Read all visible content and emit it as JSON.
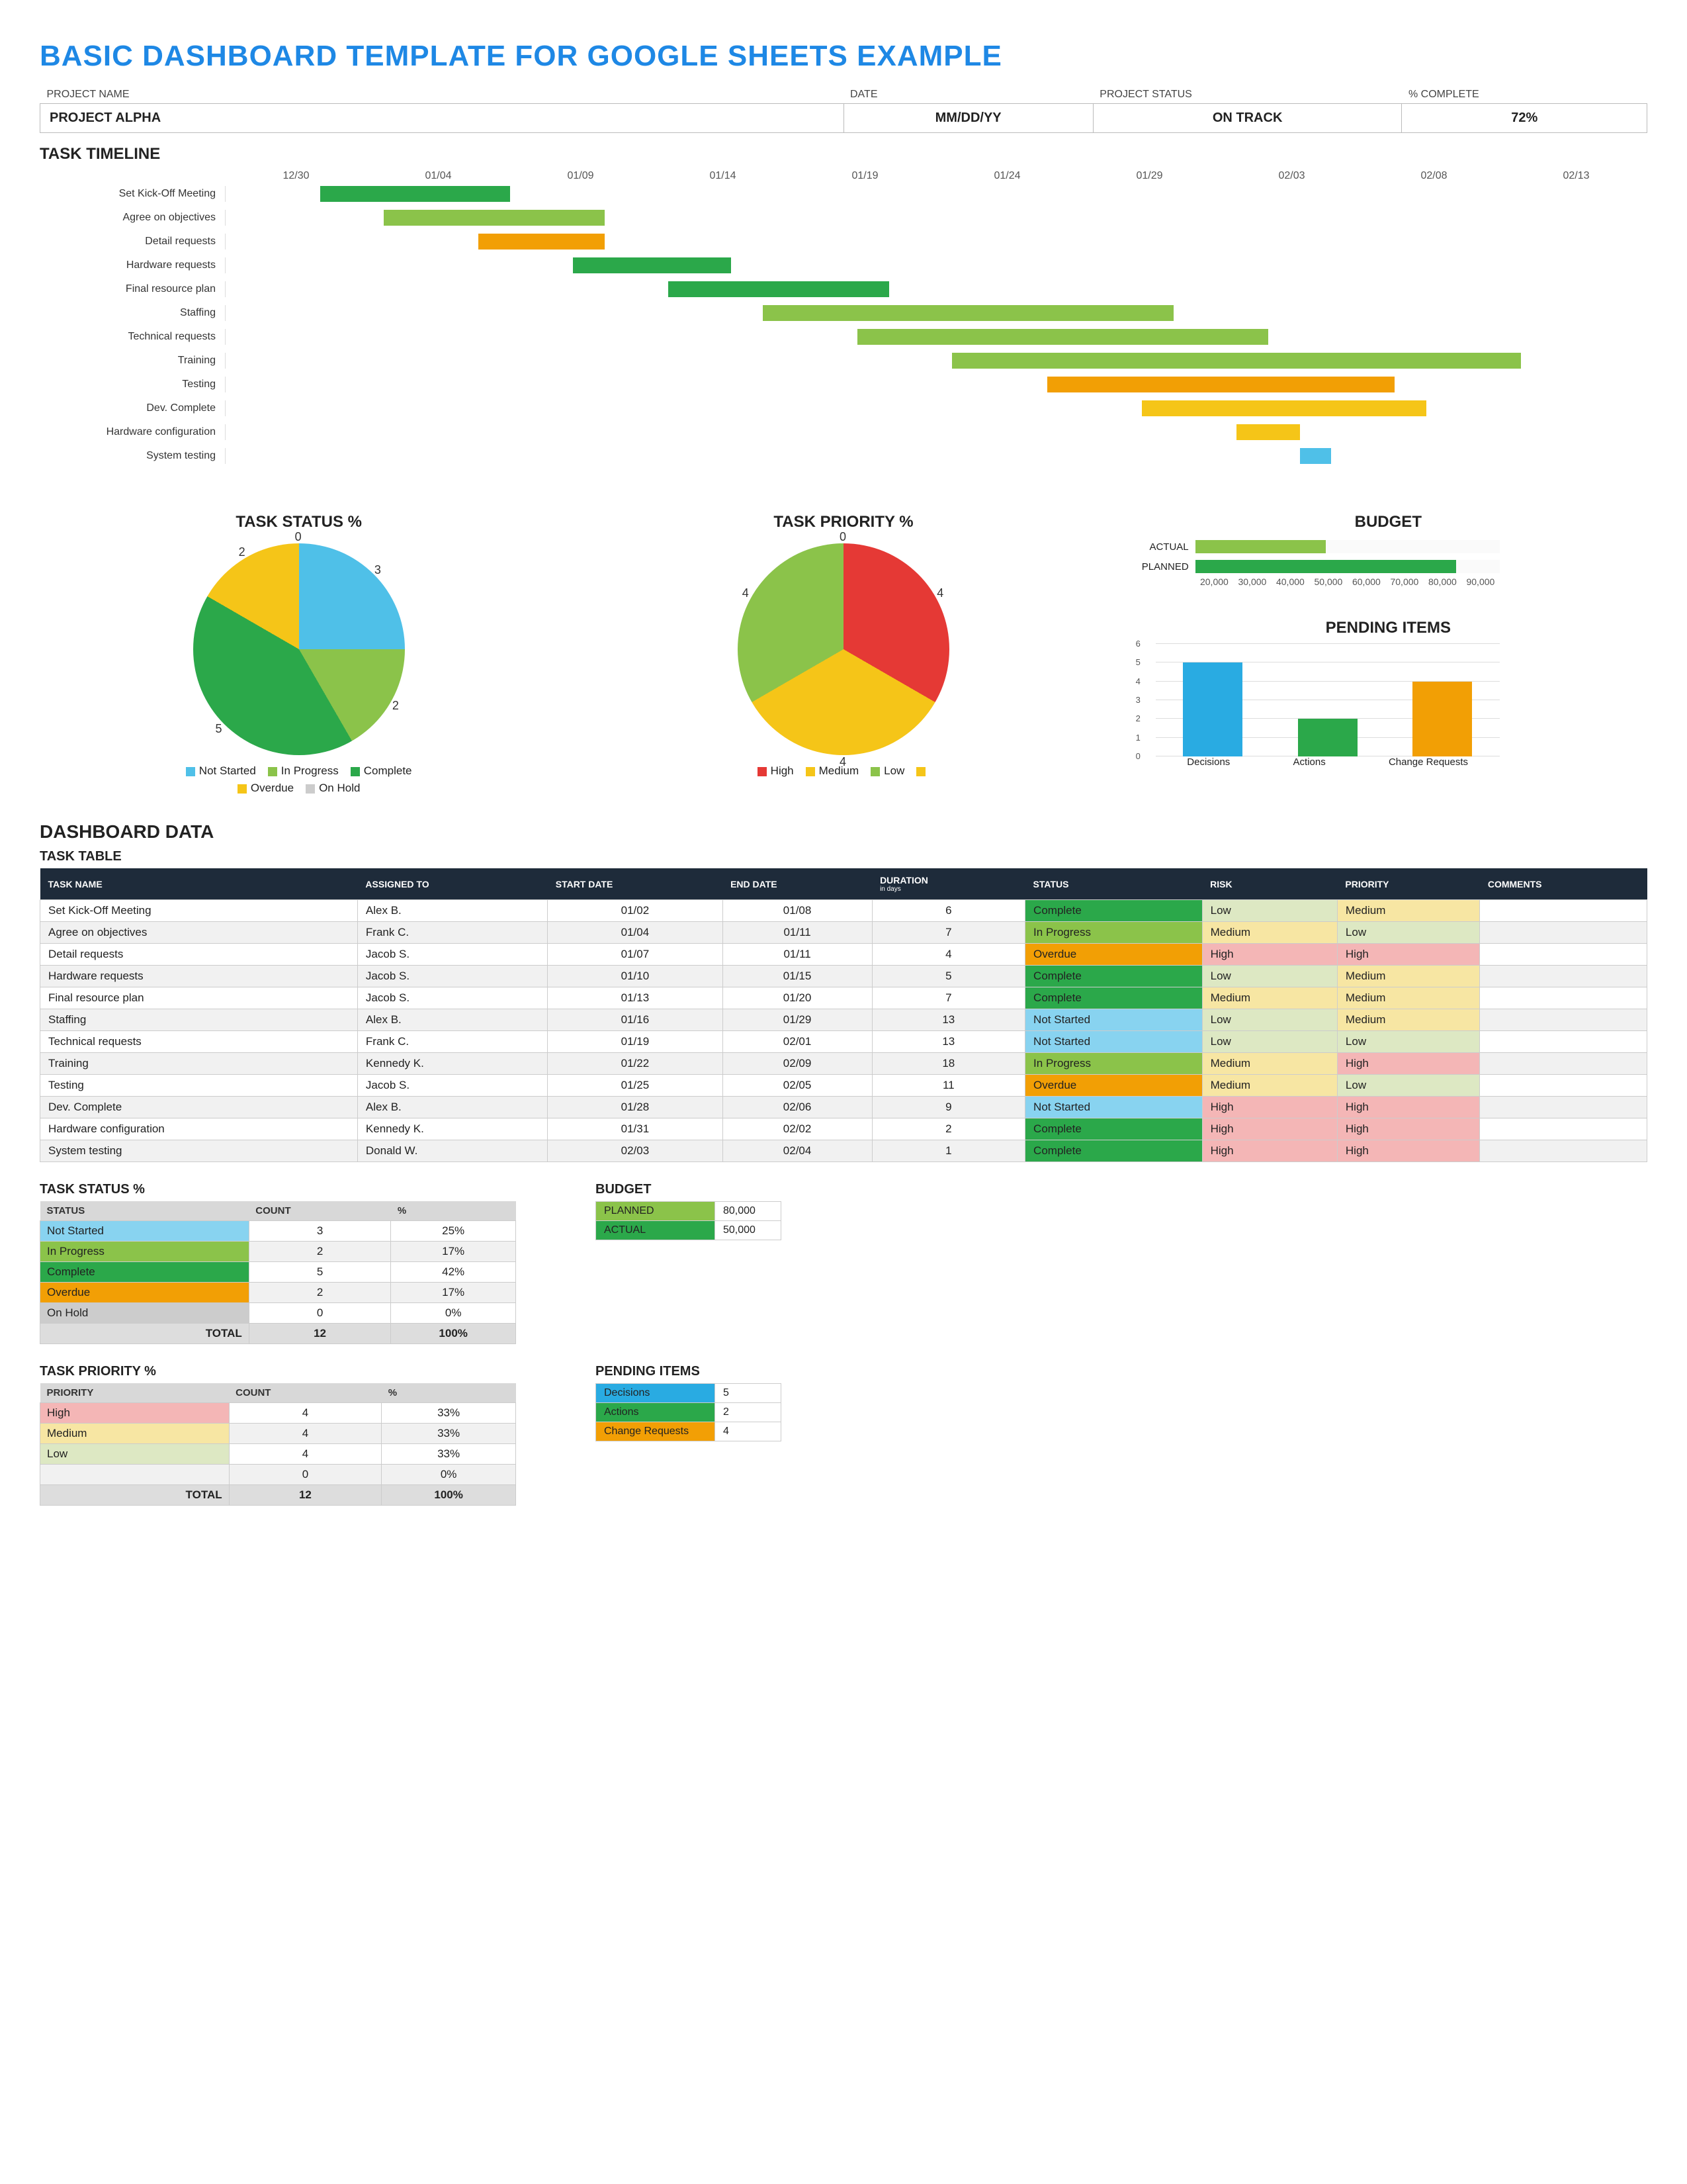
{
  "title": "BASIC DASHBOARD TEMPLATE FOR GOOGLE SHEETS EXAMPLE",
  "meta": {
    "headers": {
      "project_name": "PROJECT NAME",
      "date": "DATE",
      "status": "PROJECT STATUS",
      "complete": "% COMPLETE"
    },
    "values": {
      "project_name": "PROJECT ALPHA",
      "date": "MM/DD/YY",
      "status": "ON TRACK",
      "complete": "72%"
    }
  },
  "sections": {
    "timeline": "TASK TIMELINE",
    "status_pct": "TASK STATUS %",
    "priority_pct": "TASK PRIORITY %",
    "budget": "BUDGET",
    "pending": "PENDING ITEMS",
    "dashboard_data": "DASHBOARD DATA",
    "task_table": "TASK TABLE"
  },
  "colors": {
    "green_dark": "#2BA84A",
    "green_light": "#8BC34A",
    "yellow": "#F5C518",
    "orange": "#F29F05",
    "orange2": "#F29F05",
    "blue": "#4FC0E8",
    "blue2": "#29ABE2",
    "red": "#E53935",
    "grey": "#CCCCCC",
    "hi_bg": "#F4B6B6",
    "med_bg": "#F7E6A3",
    "low_bg": "#DDE8C3",
    "status_complete": "#2BA84A",
    "status_inprogress": "#8BC34A",
    "status_overdue": "#F29F05",
    "status_notstarted": "#88D3F0",
    "status_hold": "#CCCCCC"
  },
  "chart_data": [
    {
      "type": "bar",
      "name": "gantt",
      "categories": [
        "12/30",
        "01/04",
        "01/09",
        "01/14",
        "01/19",
        "01/24",
        "01/29",
        "02/03",
        "02/08",
        "02/13"
      ],
      "x_start": 0,
      "x_end": 45,
      "series": [
        {
          "name": "Set Kick-Off Meeting",
          "start": 3,
          "dur": 6,
          "color": "green_dark"
        },
        {
          "name": "Agree on objectives",
          "start": 5,
          "dur": 7,
          "color": "green_light"
        },
        {
          "name": "Detail requests",
          "start": 8,
          "dur": 4,
          "color": "orange"
        },
        {
          "name": "Hardware requests",
          "start": 11,
          "dur": 5,
          "color": "green_dark"
        },
        {
          "name": "Final resource plan",
          "start": 14,
          "dur": 7,
          "color": "green_dark"
        },
        {
          "name": "Staffing",
          "start": 17,
          "dur": 13,
          "color": "green_light"
        },
        {
          "name": "Technical requests",
          "start": 20,
          "dur": 13,
          "color": "green_light"
        },
        {
          "name": "Training",
          "start": 23,
          "dur": 18,
          "color": "green_light"
        },
        {
          "name": "Testing",
          "start": 26,
          "dur": 11,
          "color": "orange"
        },
        {
          "name": "Dev. Complete",
          "start": 29,
          "dur": 9,
          "color": "yellow"
        },
        {
          "name": "Hardware configuration",
          "start": 32,
          "dur": 2,
          "color": "yellow"
        },
        {
          "name": "System testing",
          "start": 34,
          "dur": 1,
          "color": "blue"
        }
      ]
    },
    {
      "type": "pie",
      "name": "task_status",
      "title": "TASK STATUS %",
      "labels": [
        "Not Started",
        "In Progress",
        "Complete",
        "Overdue",
        "On Hold"
      ],
      "values": [
        3,
        2,
        5,
        2,
        0
      ],
      "colors": [
        "blue",
        "green_light",
        "green_dark",
        "yellow",
        "grey"
      ]
    },
    {
      "type": "pie",
      "name": "task_priority",
      "title": "TASK PRIORITY %",
      "labels": [
        "High",
        "Medium",
        "Low",
        ""
      ],
      "values": [
        4,
        4,
        4,
        0
      ],
      "colors": [
        "red",
        "yellow",
        "green_light",
        "yellow"
      ]
    },
    {
      "type": "bar",
      "name": "budget",
      "orientation": "horizontal",
      "title": "BUDGET",
      "categories": [
        "ACTUAL",
        "PLANNED"
      ],
      "values": [
        50000,
        80000
      ],
      "colors": [
        "green_light",
        "green_dark"
      ],
      "xticks": [
        "20,000",
        "30,000",
        "40,000",
        "50,000",
        "60,000",
        "70,000",
        "80,000",
        "90,000"
      ],
      "xlim": [
        20000,
        90000
      ]
    },
    {
      "type": "bar",
      "name": "pending",
      "orientation": "vertical",
      "title": "PENDING ITEMS",
      "categories": [
        "Decisions",
        "Actions",
        "Change Requests"
      ],
      "values": [
        5,
        2,
        4
      ],
      "colors": [
        "blue2",
        "green_dark",
        "orange"
      ],
      "ylim": [
        0,
        6
      ],
      "yticks": [
        0,
        1,
        2,
        3,
        4,
        5,
        6
      ]
    }
  ],
  "task_table": {
    "headers": [
      "TASK NAME",
      "ASSIGNED TO",
      "START DATE",
      "END DATE",
      "DURATION",
      "STATUS",
      "RISK",
      "PRIORITY",
      "COMMENTS"
    ],
    "header_sub": {
      "4": "in days"
    },
    "rows": [
      [
        "Set Kick-Off Meeting",
        "Alex B.",
        "01/02",
        "01/08",
        "6",
        "Complete",
        "Low",
        "Medium",
        ""
      ],
      [
        "Agree on objectives",
        "Frank C.",
        "01/04",
        "01/11",
        "7",
        "In Progress",
        "Medium",
        "Low",
        ""
      ],
      [
        "Detail requests",
        "Jacob S.",
        "01/07",
        "01/11",
        "4",
        "Overdue",
        "High",
        "High",
        ""
      ],
      [
        "Hardware requests",
        "Jacob S.",
        "01/10",
        "01/15",
        "5",
        "Complete",
        "Low",
        "Medium",
        ""
      ],
      [
        "Final resource plan",
        "Jacob S.",
        "01/13",
        "01/20",
        "7",
        "Complete",
        "Medium",
        "Medium",
        ""
      ],
      [
        "Staffing",
        "Alex B.",
        "01/16",
        "01/29",
        "13",
        "Not Started",
        "Low",
        "Medium",
        ""
      ],
      [
        "Technical requests",
        "Frank C.",
        "01/19",
        "02/01",
        "13",
        "Not Started",
        "Low",
        "Low",
        ""
      ],
      [
        "Training",
        "Kennedy K.",
        "01/22",
        "02/09",
        "18",
        "In Progress",
        "Medium",
        "High",
        ""
      ],
      [
        "Testing",
        "Jacob S.",
        "01/25",
        "02/05",
        "11",
        "Overdue",
        "Medium",
        "Low",
        ""
      ],
      [
        "Dev. Complete",
        "Alex B.",
        "01/28",
        "02/06",
        "9",
        "Not Started",
        "High",
        "High",
        ""
      ],
      [
        "Hardware configuration",
        "Kennedy K.",
        "01/31",
        "02/02",
        "2",
        "Complete",
        "High",
        "High",
        ""
      ],
      [
        "System testing",
        "Donald W.",
        "02/03",
        "02/04",
        "1",
        "Complete",
        "High",
        "High",
        ""
      ]
    ]
  },
  "status_table": {
    "title": "TASK STATUS %",
    "headers": [
      "STATUS",
      "COUNT",
      "%"
    ],
    "rows": [
      [
        "Not Started",
        "3",
        "25%",
        "status_notstarted"
      ],
      [
        "In Progress",
        "2",
        "17%",
        "status_inprogress"
      ],
      [
        "Complete",
        "5",
        "42%",
        "status_complete"
      ],
      [
        "Overdue",
        "2",
        "17%",
        "status_overdue"
      ],
      [
        "On Hold",
        "0",
        "0%",
        "status_hold"
      ]
    ],
    "total": [
      "TOTAL",
      "12",
      "100%"
    ]
  },
  "priority_table": {
    "title": "TASK PRIORITY %",
    "headers": [
      "PRIORITY",
      "COUNT",
      "%"
    ],
    "rows": [
      [
        "High",
        "4",
        "33%",
        "hi_bg"
      ],
      [
        "Medium",
        "4",
        "33%",
        "med_bg"
      ],
      [
        "Low",
        "4",
        "33%",
        "low_bg"
      ],
      [
        "",
        "0",
        "0%",
        ""
      ]
    ],
    "total": [
      "TOTAL",
      "12",
      "100%"
    ]
  },
  "budget_table": {
    "title": "BUDGET",
    "rows": [
      [
        "PLANNED",
        "80,000",
        "green_light"
      ],
      [
        "ACTUAL",
        "50,000",
        "green_dark"
      ]
    ]
  },
  "pending_table": {
    "title": "PENDING ITEMS",
    "rows": [
      [
        "Decisions",
        "5",
        "blue2"
      ],
      [
        "Actions",
        "2",
        "green_dark"
      ],
      [
        "Change Requests",
        "4",
        "orange"
      ]
    ]
  }
}
